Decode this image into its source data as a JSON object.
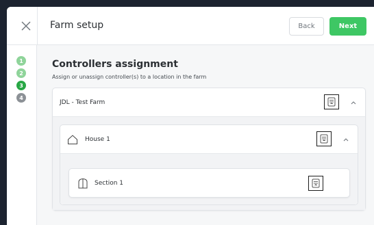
{
  "header": {
    "title": "Farm setup",
    "back_label": "Back",
    "next_label": "Next"
  },
  "stepper": {
    "steps": [
      {
        "number": "1",
        "state": "done"
      },
      {
        "number": "2",
        "state": "done"
      },
      {
        "number": "3",
        "state": "active"
      },
      {
        "number": "4",
        "state": "pending"
      }
    ]
  },
  "main": {
    "title": "Controllers assignment",
    "subtitle": "Assign or unassign controller(s) to a location in the farm",
    "farm": {
      "name": "JDL - Test Farm",
      "house": {
        "name": "House 1",
        "section": {
          "name": "Section 1"
        }
      }
    }
  },
  "colors": {
    "accent": "#3ec764",
    "step_done": "#8fd49a",
    "step_active": "#28a745",
    "step_pending": "#8c9196"
  },
  "icons": [
    "close-icon",
    "assign-controller-icon",
    "chevron-up-icon",
    "house-icon",
    "section-icon"
  ]
}
